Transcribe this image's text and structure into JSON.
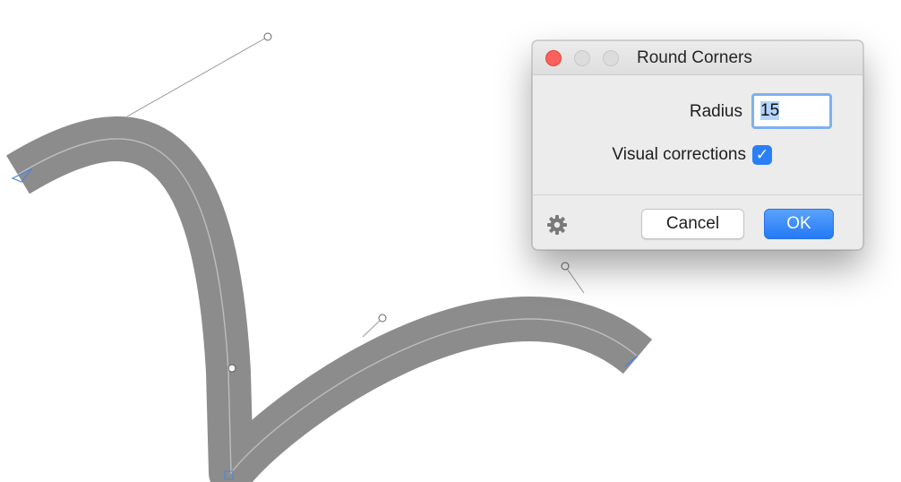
{
  "dialog": {
    "title": "Round Corners",
    "radius_label": "Radius",
    "radius_value": "15",
    "visual_corrections_label": "Visual corrections",
    "visual_corrections_checked": true,
    "cancel_label": "Cancel",
    "ok_label": "OK"
  },
  "icons": {
    "close": "close-icon",
    "minimize": "minimize-icon",
    "zoom": "zoom-icon",
    "settings": "gear-icon",
    "checkmark": "checkmark-icon"
  },
  "colors": {
    "stroke_fill": "#8c8c8c",
    "accent": "#2a7ff7",
    "close_button": "#fc615d",
    "handle_line": "#9a9a9a"
  }
}
